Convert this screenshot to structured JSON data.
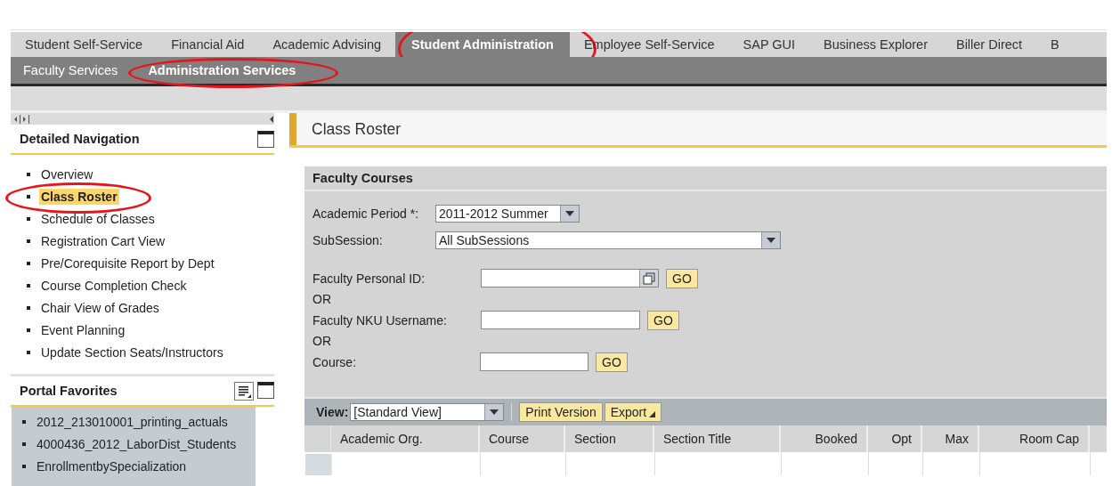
{
  "top_tabs": [
    {
      "label": "Student Self-Service",
      "selected": false,
      "circled": false
    },
    {
      "label": "Financial Aid",
      "selected": false,
      "circled": false
    },
    {
      "label": "Academic Advising",
      "selected": false,
      "circled": false
    },
    {
      "label": "Student Administration",
      "selected": true,
      "circled": true
    },
    {
      "label": "Employee Self-Service",
      "selected": false,
      "circled": false
    },
    {
      "label": "SAP GUI",
      "selected": false,
      "circled": false
    },
    {
      "label": "Business Explorer",
      "selected": false,
      "circled": false
    },
    {
      "label": "Biller Direct",
      "selected": false,
      "circled": false
    },
    {
      "label": "B",
      "selected": false,
      "circled": false
    }
  ],
  "sub_tabs": [
    {
      "label": "Faculty Services",
      "selected": false,
      "circled": false
    },
    {
      "label": "Administration Services",
      "selected": true,
      "circled": true
    }
  ],
  "detailed_navigation": {
    "title": "Detailed Navigation",
    "items": [
      {
        "label": "Overview",
        "selected": false,
        "circled": false
      },
      {
        "label": "Class Roster",
        "selected": true,
        "circled": true
      },
      {
        "label": "Schedule of Classes",
        "selected": false,
        "circled": false
      },
      {
        "label": "Registration Cart View",
        "selected": false,
        "circled": false
      },
      {
        "label": "Pre/Corequisite Report by Dept",
        "selected": false,
        "circled": false
      },
      {
        "label": "Course Completion Check",
        "selected": false,
        "circled": false
      },
      {
        "label": "Chair View of Grades",
        "selected": false,
        "circled": false
      },
      {
        "label": "Event Planning",
        "selected": false,
        "circled": false
      },
      {
        "label": "Update Section Seats/Instructors",
        "selected": false,
        "circled": false
      }
    ]
  },
  "portal_favorites": {
    "title": "Portal Favorites",
    "items": [
      "2012_213010001_printing_actuals",
      "4000436_2012_LaborDist_Students",
      "EnrollmentbySpecialization"
    ]
  },
  "page_title": "Class Roster",
  "faculty_courses": {
    "title": "Faculty Courses",
    "rows": [
      {
        "kind": "select",
        "label": "Academic Period *:",
        "value": "2011-2012 Summer"
      },
      {
        "kind": "select",
        "label": "SubSession:",
        "value": "All SubSessions"
      },
      {
        "kind": "lookup",
        "label": "Faculty Personal ID:",
        "button": "GO"
      },
      {
        "kind": "or",
        "label": "OR"
      },
      {
        "kind": "text",
        "label": "Faculty NKU Username:",
        "button": "GO"
      },
      {
        "kind": "or",
        "label": "OR"
      },
      {
        "kind": "text",
        "label": "Course:",
        "button": "GO"
      }
    ]
  },
  "table": {
    "view_label": "View:",
    "view_value": "[Standard View]",
    "buttons": [
      "Print Version",
      "Export"
    ],
    "columns": [
      {
        "label": "Academic Org.",
        "numeric": false
      },
      {
        "label": "Course",
        "numeric": false
      },
      {
        "label": "Section",
        "numeric": false
      },
      {
        "label": "Section Title",
        "numeric": false
      },
      {
        "label": "Booked",
        "numeric": true
      },
      {
        "label": "Opt",
        "numeric": true
      },
      {
        "label": "Max",
        "numeric": true
      },
      {
        "label": "Room Cap",
        "numeric": true
      }
    ]
  }
}
